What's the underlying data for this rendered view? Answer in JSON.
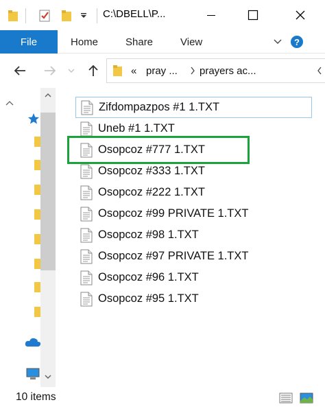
{
  "window": {
    "title": "C:\\DBELL\\P..."
  },
  "ribbon": {
    "file_label": "File",
    "tabs": [
      {
        "label": "Home"
      },
      {
        "label": "Share"
      },
      {
        "label": "View"
      }
    ]
  },
  "address": {
    "overflow": "«",
    "segments": [
      "pray ...",
      "prayers ac..."
    ]
  },
  "files": [
    {
      "name": "Zifdompazpos #1 1.TXT"
    },
    {
      "name": "Uneb #1 1.TXT"
    },
    {
      "name": "Osopcoz #777 1.TXT"
    },
    {
      "name": "Osopcoz #333 1.TXT"
    },
    {
      "name": "Osopcoz #222 1.TXT"
    },
    {
      "name": "Osopcoz #99 PRIVATE 1.TXT"
    },
    {
      "name": "Osopcoz #98 1.TXT"
    },
    {
      "name": "Osopcoz #97 PRIVATE 1.TXT"
    },
    {
      "name": "Osopcoz #96 1.TXT"
    },
    {
      "name": "Osopcoz #95 1.TXT"
    }
  ],
  "status": {
    "item_count": "10 items"
  },
  "colors": {
    "accent": "#1979ca",
    "highlight_box": "#1aa33b",
    "folder": "#f2c744"
  }
}
